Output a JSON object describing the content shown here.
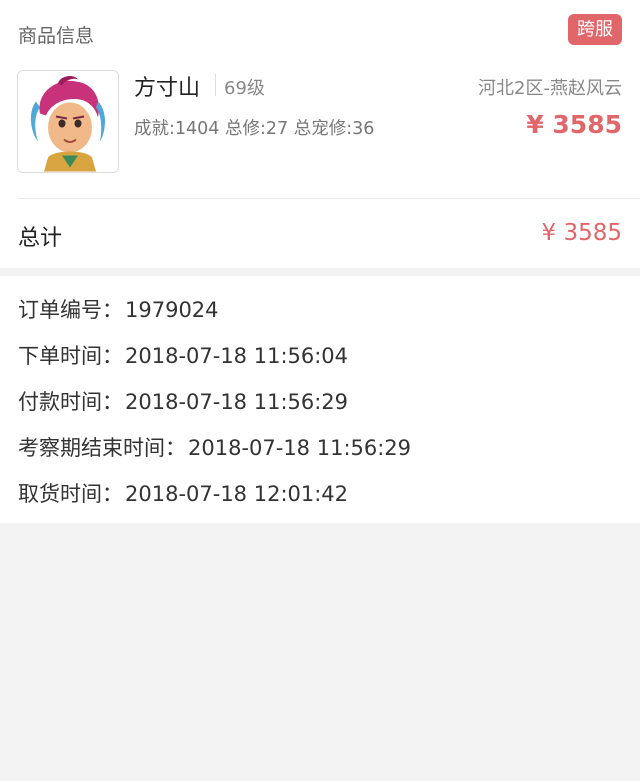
{
  "product_section": {
    "title": "商品信息",
    "badge": "跨服",
    "item": {
      "name": "方寸山",
      "level": "69级",
      "server": "河北2区-燕赵风云",
      "stats": "成就:1404 总修:27 总宠修:36",
      "price": "¥ 3585",
      "thumbnail_icon": "character-portrait-icon"
    }
  },
  "total": {
    "label": "总计",
    "value": "¥ 3585"
  },
  "order_info": {
    "rows": [
      {
        "label": "订单编号：",
        "value": "1979024"
      },
      {
        "label": "下单时间：",
        "value": "2018-07-18 11:56:04"
      },
      {
        "label": "付款时间：",
        "value": "2018-07-18 11:56:29"
      },
      {
        "label": "考察期结束时间：",
        "value": "2018-07-18 11:56:29"
      },
      {
        "label": "取货时间：",
        "value": "2018-07-18 12:01:42"
      }
    ]
  },
  "colors": {
    "accent": "#e0666a",
    "background": "#f3f3f3",
    "card": "#ffffff"
  }
}
